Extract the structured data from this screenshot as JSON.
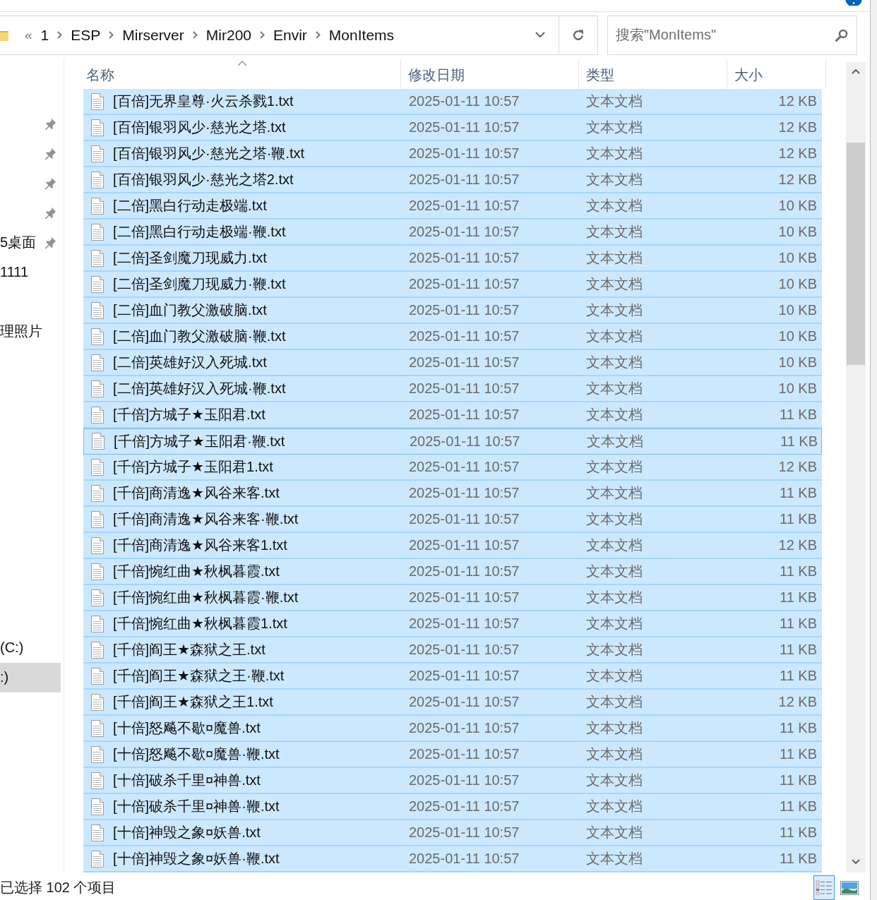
{
  "address_bar": {
    "overflow_mark": "«",
    "breadcrumbs": [
      "1",
      "ESP",
      "Mirserver",
      "Mir200",
      "Envir",
      "MonItems"
    ]
  },
  "search": {
    "placeholder": "搜索\"MonItems\""
  },
  "sidebar": {
    "items": [
      {
        "pinned": true,
        "selected": false
      },
      {
        "pinned": true,
        "selected": false
      },
      {
        "pinned": true,
        "selected": false
      },
      {
        "pinned": true,
        "selected": false
      },
      {
        "label": "5桌面",
        "pinned": true,
        "selected": false
      },
      {
        "label": "1111",
        "pinned": false,
        "selected": false
      },
      {
        "pinned": false,
        "selected": false
      },
      {
        "label": "理照片",
        "pinned": false,
        "selected": false
      }
    ],
    "drives": [
      {
        "label": "(C:)",
        "selected": false
      },
      {
        "label": ":)",
        "selected": true
      }
    ]
  },
  "table": {
    "columns": [
      {
        "label": "名称",
        "sorted": true
      },
      {
        "label": "修改日期",
        "sorted": false
      },
      {
        "label": "类型",
        "sorted": false
      },
      {
        "label": "大小",
        "sorted": false
      }
    ],
    "rows": [
      {
        "name": "[百倍]无界皇尊·火云杀戮1.txt",
        "modified": "2025-01-11 10:57",
        "type": "文本文档",
        "size": "12 KB",
        "selected": true,
        "focused": false
      },
      {
        "name": "[百倍]银羽风少·慈光之塔.txt",
        "modified": "2025-01-11 10:57",
        "type": "文本文档",
        "size": "12 KB",
        "selected": true,
        "focused": false
      },
      {
        "name": "[百倍]银羽风少·慈光之塔·鞭.txt",
        "modified": "2025-01-11 10:57",
        "type": "文本文档",
        "size": "12 KB",
        "selected": true,
        "focused": false
      },
      {
        "name": "[百倍]银羽风少·慈光之塔2.txt",
        "modified": "2025-01-11 10:57",
        "type": "文本文档",
        "size": "12 KB",
        "selected": true,
        "focused": false
      },
      {
        "name": "[二倍]黑白行动走极端.txt",
        "modified": "2025-01-11 10:57",
        "type": "文本文档",
        "size": "10 KB",
        "selected": true,
        "focused": false
      },
      {
        "name": "[二倍]黑白行动走极端·鞭.txt",
        "modified": "2025-01-11 10:57",
        "type": "文本文档",
        "size": "10 KB",
        "selected": true,
        "focused": false
      },
      {
        "name": "[二倍]圣剑魔刀现威力.txt",
        "modified": "2025-01-11 10:57",
        "type": "文本文档",
        "size": "10 KB",
        "selected": true,
        "focused": false
      },
      {
        "name": "[二倍]圣剑魔刀现威力·鞭.txt",
        "modified": "2025-01-11 10:57",
        "type": "文本文档",
        "size": "10 KB",
        "selected": true,
        "focused": false
      },
      {
        "name": "[二倍]血门教父激破脑.txt",
        "modified": "2025-01-11 10:57",
        "type": "文本文档",
        "size": "10 KB",
        "selected": true,
        "focused": false
      },
      {
        "name": "[二倍]血门教父激破脑·鞭.txt",
        "modified": "2025-01-11 10:57",
        "type": "文本文档",
        "size": "10 KB",
        "selected": true,
        "focused": false
      },
      {
        "name": "[二倍]英雄好汉入死城.txt",
        "modified": "2025-01-11 10:57",
        "type": "文本文档",
        "size": "10 KB",
        "selected": true,
        "focused": false
      },
      {
        "name": "[二倍]英雄好汉入死城·鞭.txt",
        "modified": "2025-01-11 10:57",
        "type": "文本文档",
        "size": "10 KB",
        "selected": true,
        "focused": false
      },
      {
        "name": "[千倍]方城子★玉阳君.txt",
        "modified": "2025-01-11 10:57",
        "type": "文本文档",
        "size": "11 KB",
        "selected": true,
        "focused": false
      },
      {
        "name": "[千倍]方城子★玉阳君·鞭.txt",
        "modified": "2025-01-11 10:57",
        "type": "文本文档",
        "size": "11 KB",
        "selected": true,
        "focused": true
      },
      {
        "name": "[千倍]方城子★玉阳君1.txt",
        "modified": "2025-01-11 10:57",
        "type": "文本文档",
        "size": "12 KB",
        "selected": true,
        "focused": false
      },
      {
        "name": "[千倍]商清逸★风谷来客.txt",
        "modified": "2025-01-11 10:57",
        "type": "文本文档",
        "size": "11 KB",
        "selected": true,
        "focused": false
      },
      {
        "name": "[千倍]商清逸★风谷来客·鞭.txt",
        "modified": "2025-01-11 10:57",
        "type": "文本文档",
        "size": "11 KB",
        "selected": true,
        "focused": false
      },
      {
        "name": "[千倍]商清逸★风谷来客1.txt",
        "modified": "2025-01-11 10:57",
        "type": "文本文档",
        "size": "12 KB",
        "selected": true,
        "focused": false
      },
      {
        "name": "[千倍]惋红曲★秋枫暮霞.txt",
        "modified": "2025-01-11 10:57",
        "type": "文本文档",
        "size": "11 KB",
        "selected": true,
        "focused": false
      },
      {
        "name": "[千倍]惋红曲★秋枫暮霞·鞭.txt",
        "modified": "2025-01-11 10:57",
        "type": "文本文档",
        "size": "11 KB",
        "selected": true,
        "focused": false
      },
      {
        "name": "[千倍]惋红曲★秋枫暮霞1.txt",
        "modified": "2025-01-11 10:57",
        "type": "文本文档",
        "size": "11 KB",
        "selected": true,
        "focused": false
      },
      {
        "name": "[千倍]阎王★森狱之王.txt",
        "modified": "2025-01-11 10:57",
        "type": "文本文档",
        "size": "11 KB",
        "selected": true,
        "focused": false
      },
      {
        "name": "[千倍]阎王★森狱之王·鞭.txt",
        "modified": "2025-01-11 10:57",
        "type": "文本文档",
        "size": "11 KB",
        "selected": true,
        "focused": false
      },
      {
        "name": "[千倍]阎王★森狱之王1.txt",
        "modified": "2025-01-11 10:57",
        "type": "文本文档",
        "size": "12 KB",
        "selected": true,
        "focused": false
      },
      {
        "name": "[十倍]怒飚不歇¤魔兽.txt",
        "modified": "2025-01-11 10:57",
        "type": "文本文档",
        "size": "11 KB",
        "selected": true,
        "focused": false
      },
      {
        "name": "[十倍]怒飚不歇¤魔兽·鞭.txt",
        "modified": "2025-01-11 10:57",
        "type": "文本文档",
        "size": "11 KB",
        "selected": true,
        "focused": false
      },
      {
        "name": "[十倍]破杀千里¤神兽.txt",
        "modified": "2025-01-11 10:57",
        "type": "文本文档",
        "size": "11 KB",
        "selected": true,
        "focused": false
      },
      {
        "name": "[十倍]破杀千里¤神兽·鞭.txt",
        "modified": "2025-01-11 10:57",
        "type": "文本文档",
        "size": "11 KB",
        "selected": true,
        "focused": false
      },
      {
        "name": "[十倍]神毁之象¤妖兽.txt",
        "modified": "2025-01-11 10:57",
        "type": "文本文档",
        "size": "11 KB",
        "selected": true,
        "focused": false
      },
      {
        "name": "[十倍]神毁之象¤妖兽·鞭.txt",
        "modified": "2025-01-11 10:57",
        "type": "文本文档",
        "size": "11 KB",
        "selected": true,
        "focused": false
      }
    ]
  },
  "status_bar": {
    "text": "已选择 102 个项目",
    "view_buttons": [
      {
        "kind": "details",
        "selected": true
      },
      {
        "kind": "large_icons",
        "selected": false
      }
    ]
  }
}
